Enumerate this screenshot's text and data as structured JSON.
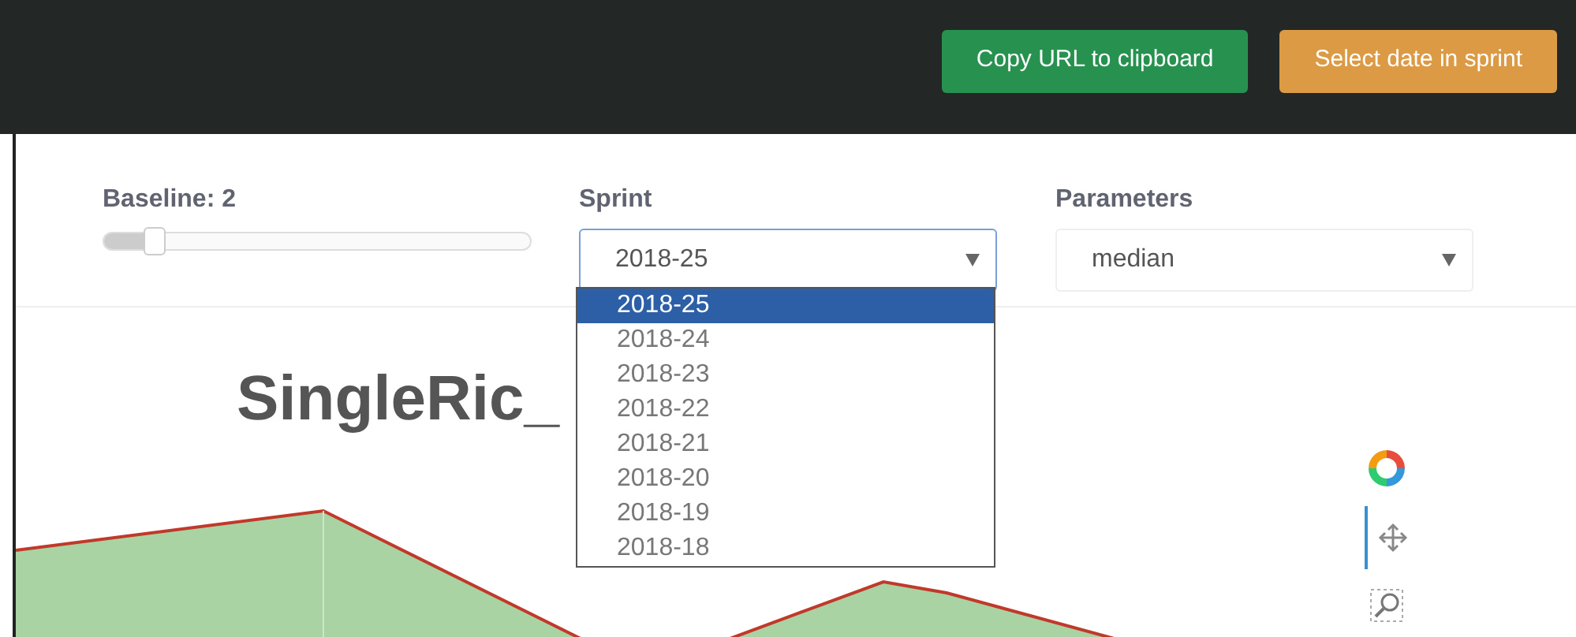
{
  "header": {
    "buttons": [
      {
        "label": "Copy URL to clipboard",
        "kind": "success"
      },
      {
        "label": "Select date in sprint",
        "kind": "warning"
      }
    ]
  },
  "controls": {
    "baseline": {
      "label": "Baseline: 2",
      "level": 0.12
    },
    "sprint": {
      "label": "Sprint",
      "value": "2018-25",
      "expanded": true,
      "options": [
        {
          "label": "2018-25",
          "selected": true
        },
        {
          "label": "2018-24",
          "selected": false
        },
        {
          "label": "2018-23",
          "selected": false
        },
        {
          "label": "2018-22",
          "selected": false
        },
        {
          "label": "2018-21",
          "selected": false
        },
        {
          "label": "2018-20",
          "selected": false
        },
        {
          "label": "2018-19",
          "selected": false
        },
        {
          "label": "2018-18",
          "selected": false
        }
      ]
    },
    "parameters": {
      "label": "Parameters",
      "value": "median"
    }
  },
  "chart": {
    "title": "SingleRic_"
  }
}
